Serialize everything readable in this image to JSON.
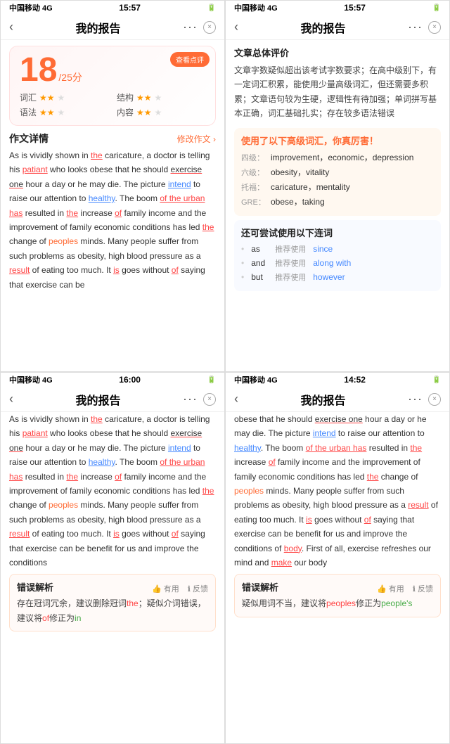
{
  "panels": {
    "tl": {
      "status": {
        "left": "中国移动 4G",
        "center": "15:57",
        "right": "🔋"
      },
      "nav": {
        "title": "我的报告",
        "back": "‹",
        "dots": "···",
        "close": "×"
      },
      "score_badge": "查看点评",
      "score": {
        "value": "18",
        "denom": "/25分"
      },
      "ratings": [
        {
          "label": "词汇",
          "stars": 2
        },
        {
          "label": "结构",
          "stars": 2
        },
        {
          "label": "语法",
          "stars": 2
        },
        {
          "label": "内容",
          "stars": 2
        }
      ],
      "section_title": "作文详情",
      "section_link": "修改作文 ›",
      "essay": "As is vividly shown in the caricature, a doctor is telling his patiant who looks obese that he should exercise one hour a day or he may die. The picture intend to raise our attention to healthy. The boom of the urban has resulted in the increase of family income and the improvement of family economic conditions has led the change of peoples minds. Many people suffer from such problems as obesity, high blood pressure as a result of eating too much. It is goes without of saying that exercise can be"
    },
    "tr": {
      "status": {
        "left": "中国移动 4G",
        "center": "15:57",
        "right": "🔋"
      },
      "nav": {
        "title": "我的报告",
        "back": "‹",
        "dots": "···",
        "close": "×"
      },
      "review_title": "文章总体评价",
      "review_text": "文章字数疑似超出该考试字数要求；在高中级别下，有一定词汇积累，能使用少量高级词汇，但还需要多积累；文章语句较为生硬，逻辑性有待加强；单词拼写基本正确，词汇基础扎实；存在较多语法错误",
      "vocab_title": "使用了以下高级词汇，你真厉害！",
      "vocab_items": [
        {
          "level": "四级：",
          "words": "improvement，economic，depression"
        },
        {
          "level": "六级：",
          "words": "obesity，vitality"
        },
        {
          "level": "托福：",
          "words": "caricature，mentality"
        },
        {
          "level": "GRE：",
          "words": "obese，taking"
        }
      ],
      "conn_title": "还可尝试使用以下连词",
      "conn_items": [
        {
          "word": "as",
          "label": "推荐使用",
          "suggest": "since"
        },
        {
          "word": "and",
          "label": "推荐使用",
          "suggest": "along with"
        },
        {
          "word": "but",
          "label": "推荐使用",
          "suggest": "however"
        }
      ]
    },
    "bl": {
      "status": {
        "left": "中国移动 4G",
        "center": "16:00",
        "right": "🔋"
      },
      "nav": {
        "title": "我的报告",
        "back": "‹",
        "dots": "···",
        "close": "×"
      },
      "essay": "As is vividly shown in the caricature, a doctor is telling his patiant who looks obese that he should exercise one hour a day or he may die. The picture intend to raise our attention to healthy. The boom of the urban has resulted in the increase of family income and the improvement of family economic conditions has led the change of peoples minds. Many people suffer from such problems as obesity, high blood pressure as a result of eating too much. It is goes without of saying that exercise can be benefit for us and improve the conditions",
      "error_title": "错误解析",
      "error_actions": [
        "👍 有用",
        "ℹ 反馈"
      ],
      "error_text": "存在冠词冗余，建议删除冠词the；疑似介词错误，建议将of修正为in"
    },
    "br": {
      "status": {
        "left": "中国移动 4G",
        "center": "14:52",
        "right": "🔋"
      },
      "nav": {
        "title": "我的报告",
        "back": "‹",
        "dots": "···",
        "close": "×"
      },
      "essay": "obese that he should exercise one hour a day or he may die. The picture intend to raise our attention to healthy. The boom of the urban has resulted in the increase of family income and the improvement of family economic conditions has led the change of peoples minds. Many people suffer from such problems as obesity, high blood pressure as a result of eating too much. It is goes without of saying that exercise can be benefit for us and improve the conditions of body. First of all, exercise refreshes our mind and make our body",
      "error_title": "错误解析",
      "error_actions": [
        "👍 有用",
        "ℹ 反馈"
      ],
      "error_text": "疑似用词不当，建议将peoples修正为people's"
    }
  }
}
